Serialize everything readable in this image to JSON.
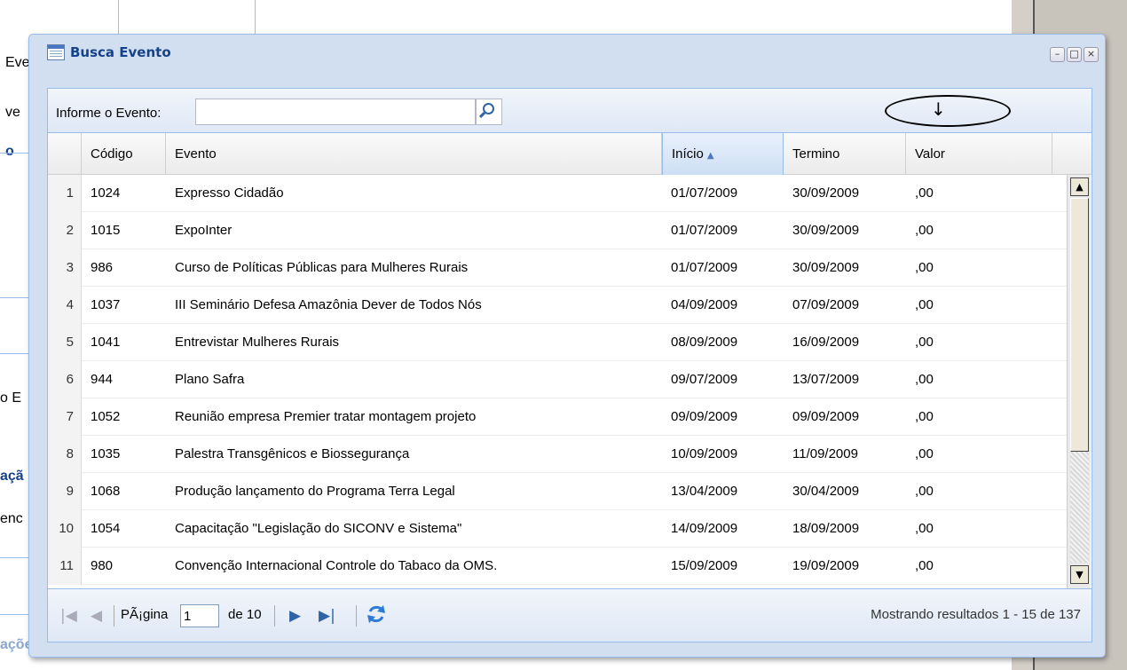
{
  "background": {
    "fragments": [
      "Evento:",
      "ve",
      "o",
      "o E",
      "açã",
      "enc",
      "ações gerais"
    ]
  },
  "window": {
    "title": "Busca Evento",
    "tools": [
      "minimize",
      "maximize",
      "close"
    ]
  },
  "toolbar": {
    "search_label": "Informe o Evento:",
    "search_value": "",
    "search_placeholder": ""
  },
  "grid": {
    "columns": [
      "Código",
      "Evento",
      "Início",
      "Termino",
      "Valor"
    ],
    "sorted_column": "Início",
    "rows": [
      {
        "n": "1",
        "codigo": "1024",
        "evento": "Expresso Cidadão",
        "inicio": "01/07/2009",
        "termino": "30/09/2009",
        "valor": ",00"
      },
      {
        "n": "2",
        "codigo": "1015",
        "evento": "ExpoInter",
        "inicio": "01/07/2009",
        "termino": "30/09/2009",
        "valor": ",00"
      },
      {
        "n": "3",
        "codigo": "986",
        "evento": "Curso de Políticas Públicas para Mulheres Rurais",
        "inicio": "01/07/2009",
        "termino": "30/09/2009",
        "valor": ",00"
      },
      {
        "n": "4",
        "codigo": "1037",
        "evento": "III Seminário Defesa Amazônia Dever de Todos Nós",
        "inicio": "04/09/2009",
        "termino": "07/09/2009",
        "valor": ",00"
      },
      {
        "n": "5",
        "codigo": "1041",
        "evento": "Entrevistar Mulheres Rurais",
        "inicio": "08/09/2009",
        "termino": "16/09/2009",
        "valor": ",00"
      },
      {
        "n": "6",
        "codigo": "944",
        "evento": "Plano Safra",
        "inicio": "09/07/2009",
        "termino": "13/07/2009",
        "valor": ",00"
      },
      {
        "n": "7",
        "codigo": "1052",
        "evento": "Reunião empresa Premier tratar montagem projeto",
        "inicio": "09/09/2009",
        "termino": "09/09/2009",
        "valor": ",00"
      },
      {
        "n": "8",
        "codigo": "1035",
        "evento": "Palestra Transgênicos e Biossegurança",
        "inicio": "10/09/2009",
        "termino": "11/09/2009",
        "valor": ",00"
      },
      {
        "n": "9",
        "codigo": "1068",
        "evento": "Produção lançamento do Programa Terra Legal",
        "inicio": "13/04/2009",
        "termino": "30/04/2009",
        "valor": ",00"
      },
      {
        "n": "10",
        "codigo": "1054",
        "evento": "Capacitação \"Legislação do SICONV e Sistema\"",
        "inicio": "14/09/2009",
        "termino": "18/09/2009",
        "valor": ",00"
      },
      {
        "n": "11",
        "codigo": "980",
        "evento": "Convenção Internacional Controle do Tabaco da OMS.",
        "inicio": "15/09/2009",
        "termino": "19/09/2009",
        "valor": ",00"
      }
    ]
  },
  "pager": {
    "page_label": "PÃ¡gina",
    "page_value": "1",
    "of_label": "de 10",
    "status": "Mostrando resultados 1 - 15 de 137"
  },
  "icons": {
    "title": "grid-window-icon",
    "search": "search-icon",
    "first": "first-page-icon",
    "prev": "prev-page-icon",
    "next": "next-page-icon",
    "last": "last-page-icon",
    "refresh": "refresh-icon"
  },
  "colors": {
    "title_text": "#15428b",
    "panel_border": "#99bbe8",
    "window_bg": "#d2dff0"
  }
}
